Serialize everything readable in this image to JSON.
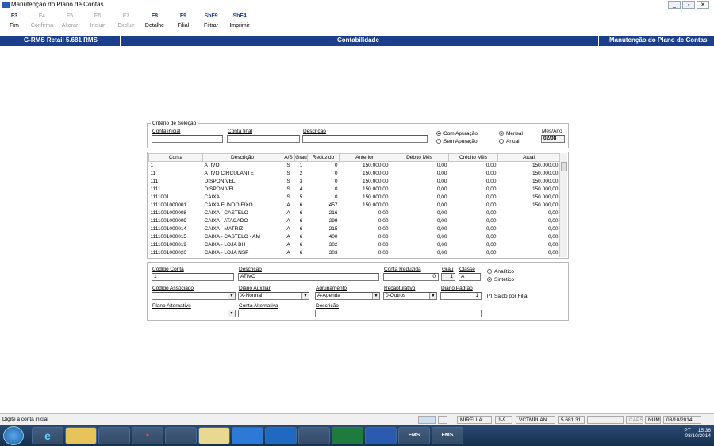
{
  "window": {
    "title": "Manutenção do Plano de Contas"
  },
  "fkeys": [
    {
      "key": "F3",
      "label": "Fim",
      "enabled": true
    },
    {
      "key": "F4",
      "label": "Confirma",
      "enabled": false
    },
    {
      "key": "F5",
      "label": "Alterar",
      "enabled": false
    },
    {
      "key": "F6",
      "label": "Incluir",
      "enabled": false
    },
    {
      "key": "F7",
      "label": "Excluir",
      "enabled": false
    },
    {
      "key": "F8",
      "label": "Detalhe",
      "enabled": true
    },
    {
      "key": "F9",
      "label": "Filial",
      "enabled": true
    },
    {
      "key": "ShF9",
      "label": "Filtrar",
      "enabled": true
    },
    {
      "key": "ShF4",
      "label": "Imprimir",
      "enabled": true
    }
  ],
  "header": {
    "app": "G-RMS Retail 5.681 RMS",
    "module": "Contabilidade",
    "screen": "Manutenção do Plano de Contas"
  },
  "criteria": {
    "title": "Critério de Seleção",
    "conta_inicial_label": "Conta inicial",
    "conta_final_label": "Conta final",
    "descricao_label": "Descrição",
    "com_apuracao": "Com Apuração",
    "sem_apuracao": "Sem Apuração",
    "mensal": "Mensal",
    "anual": "Anual",
    "mes_ano_label": "Mês/Ano",
    "mes_ano_value": "02/08"
  },
  "grid": {
    "headers": [
      "Conta",
      "Descrição",
      "A/S",
      "Grau",
      "Reduzido",
      "Anterior",
      "Débito Mês",
      "Crédito Mês",
      "Atual"
    ],
    "rows": [
      [
        "1",
        "ATIVO",
        "S",
        "1",
        "0",
        "150.000,00",
        "0,00",
        "0,00",
        "150.000,00"
      ],
      [
        "11",
        "ATIVO CIRCULANTE",
        "S",
        "2",
        "0",
        "150.000,00",
        "0,00",
        "0,00",
        "150.000,00"
      ],
      [
        "111",
        "DISPONIVEL",
        "S",
        "3",
        "0",
        "150.000,00",
        "0,00",
        "0,00",
        "150.000,00"
      ],
      [
        "1111",
        "DISPONIVEL",
        "S",
        "4",
        "0",
        "150.000,00",
        "0,00",
        "0,00",
        "150.000,00"
      ],
      [
        "1111001",
        "CAIXA",
        "S",
        "5",
        "0",
        "150.000,00",
        "0,00",
        "0,00",
        "150.000,00"
      ],
      [
        "1111001000001",
        "CAIXA FUNDO FIXO",
        "A",
        "6",
        "457",
        "150.000,00",
        "0,00",
        "0,00",
        "150.000,00"
      ],
      [
        "1111001000008",
        "CAIXA - CASTELO",
        "A",
        "6",
        "216",
        "0,00",
        "0,00",
        "0,00",
        "0,00"
      ],
      [
        "1111001000009",
        "CAIXA - ATACADO",
        "A",
        "6",
        "299",
        "0,00",
        "0,00",
        "0,00",
        "0,00"
      ],
      [
        "1111001000014",
        "CAIXA - MATRIZ",
        "A",
        "6",
        "215",
        "0,00",
        "0,00",
        "0,00",
        "0,00"
      ],
      [
        "1111001000015",
        "CAIXA - CASTELO - AM",
        "A",
        "6",
        "400",
        "0,00",
        "0,00",
        "0,00",
        "0,00"
      ],
      [
        "1111001000019",
        "CAIXA - LOJA BH",
        "A",
        "6",
        "302",
        "0,00",
        "0,00",
        "0,00",
        "0,00"
      ],
      [
        "1111001000020",
        "CAIXA - LOJA NSP",
        "A",
        "6",
        "303",
        "0,00",
        "0,00",
        "0,00",
        "0,00"
      ]
    ]
  },
  "detail": {
    "codigo_conta_label": "Código Conta",
    "codigo_conta": "1",
    "descricao_label": "Descrição",
    "descricao": "ATIVO",
    "conta_reduzida_label": "Conta Reduzida",
    "conta_reduzida": "0",
    "grau_label": "Grau",
    "grau": "1",
    "classe_label": "Classe",
    "classe": "A",
    "analitico": "Analítico",
    "sintetico": "Sintético",
    "codigo_associado_label": "Código Associado",
    "codigo_associado": "",
    "diario_auxiliar_label": "Diário Auxiliar",
    "diario_auxiliar": "X-Normal",
    "agrupamento_label": "Agrupamento",
    "agrupamento": "A-Agenda",
    "recaptulativo_label": "Recaptulativo",
    "recaptulativo": "0-Outros",
    "diario_padrao_label": "Diário Padrão",
    "diario_padrao": "1",
    "saldo_por_filial": "Saldo por Filial",
    "plano_alternativo_label": "Plano Alternativo",
    "plano_alternativo": "",
    "conta_alternativa_label": "Conta Alternativa",
    "conta_alternativa": "",
    "descricao2_label": "Descrição",
    "descricao2": ""
  },
  "status": {
    "message": "Digite a conta inicial",
    "user": "MIRELLA",
    "range": "1-9",
    "program": "VCTMPLAN",
    "version": "5.681.31",
    "caps": "CAPS",
    "num": "NUM",
    "date": "08/10/2014"
  },
  "taskbar": {
    "apps": [
      "FMS",
      "FMS"
    ],
    "lang": "PT",
    "time": "15:36",
    "date": "08/10/2014"
  }
}
